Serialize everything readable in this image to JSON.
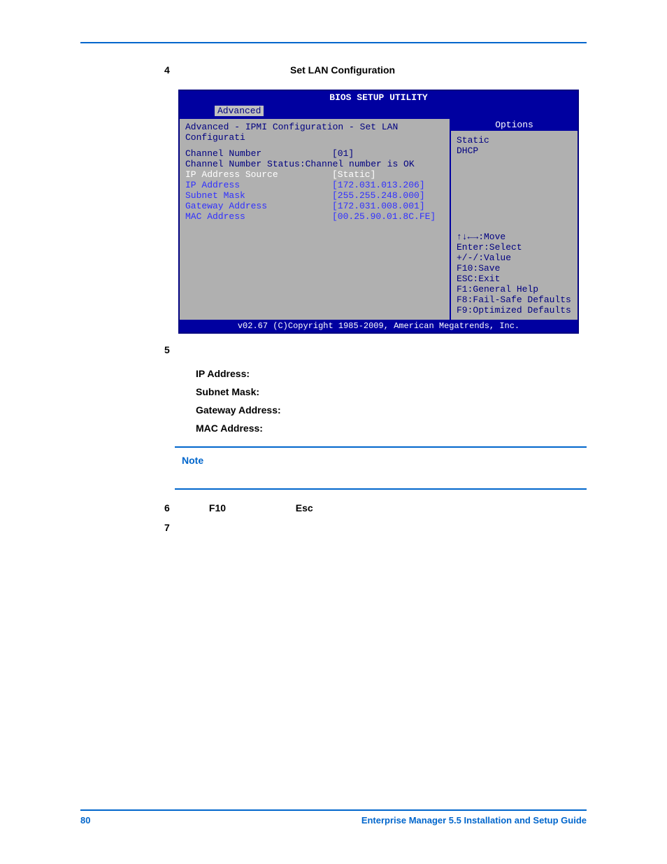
{
  "step4": {
    "num": "4",
    "label": "Set LAN Configuration"
  },
  "bios": {
    "title": "BIOS SETUP UTILITY",
    "tab": "Advanced",
    "breadcrumb": "Advanced - IPMI Configuration - Set LAN Configurati",
    "rows": {
      "channel_num_lbl": "Channel Number",
      "channel_num_val": "[01]",
      "channel_status": "Channel Number Status:Channel number is OK",
      "ip_src_lbl": "IP Address Source",
      "ip_src_val": "[Static]",
      "ip_lbl": "IP Address",
      "ip_val": "[172.031.013.206]",
      "subnet_lbl": "Subnet Mask",
      "subnet_val": "[255.255.248.000]",
      "gw_lbl": "Gateway Address",
      "gw_val": "[172.031.008.001]",
      "mac_lbl": "MAC Address",
      "mac_val": "[00.25.90.01.8C.FE]"
    },
    "options_hdr": "Options",
    "options": {
      "static": "Static",
      "dhcp": "DHCP"
    },
    "help": {
      "move": "↑↓←→:Move",
      "enter": "Enter:Select",
      "value": "+/-/:Value",
      "f10": "F10:Save",
      "esc": "ESC:Exit",
      "f1": "F1:General Help",
      "f8": "F8:Fail-Safe Defaults",
      "f9": "F9:Optimized Defaults"
    },
    "copyright": "v02.67 (C)Copyright 1985-2009, American Megatrends, Inc."
  },
  "step5": "5",
  "sub": {
    "ip": "IP Address:",
    "subnet": "Subnet Mask:",
    "gateway": "Gateway Address:",
    "mac": "MAC Address:"
  },
  "note": "Note",
  "step6": {
    "num": "6",
    "k1": "F10",
    "k2": "Esc"
  },
  "step7": "7",
  "footer": {
    "page": "80",
    "title": "Enterprise Manager 5.5 Installation and Setup Guide"
  }
}
